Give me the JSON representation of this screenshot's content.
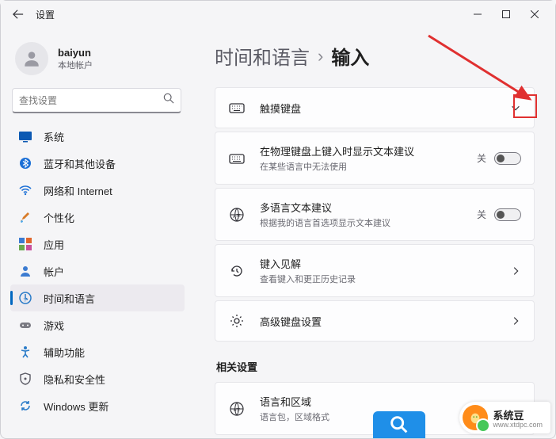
{
  "window": {
    "title": "设置"
  },
  "profile": {
    "name": "baiyun",
    "sub": "本地帐户"
  },
  "search": {
    "placeholder": "查找设置"
  },
  "nav": [
    {
      "key": "system",
      "label": "系统",
      "icon": "system"
    },
    {
      "key": "bluetooth",
      "label": "蓝牙和其他设备",
      "icon": "bluetooth"
    },
    {
      "key": "network",
      "label": "网络和 Internet",
      "icon": "wifi"
    },
    {
      "key": "personalization",
      "label": "个性化",
      "icon": "brush"
    },
    {
      "key": "apps",
      "label": "应用",
      "icon": "apps"
    },
    {
      "key": "accounts",
      "label": "帐户",
      "icon": "account"
    },
    {
      "key": "time-language",
      "label": "时间和语言",
      "icon": "time-lang",
      "active": true
    },
    {
      "key": "gaming",
      "label": "游戏",
      "icon": "gaming"
    },
    {
      "key": "accessibility",
      "label": "辅助功能",
      "icon": "accessibility"
    },
    {
      "key": "privacy",
      "label": "隐私和安全性",
      "icon": "privacy"
    },
    {
      "key": "windows-update",
      "label": "Windows 更新",
      "icon": "update"
    }
  ],
  "breadcrumb": {
    "parent": "时间和语言",
    "current": "输入"
  },
  "cards": {
    "touch_keyboard": {
      "title": "触摸键盘"
    },
    "physical_suggest": {
      "title": "在物理键盘上键入时显示文本建议",
      "sub": "在某些语言中无法使用",
      "state": "关"
    },
    "multilang_suggest": {
      "title": "多语言文本建议",
      "sub": "根据我的语言首选项显示文本建议",
      "state": "关"
    },
    "typing_insights": {
      "title": "键入见解",
      "sub": "查看键入和更正历史记录"
    },
    "advanced_keyboard": {
      "title": "高级键盘设置"
    }
  },
  "related": {
    "heading": "相关设置",
    "lang_region": {
      "title": "语言和区域",
      "sub": "语言包，区域格式"
    }
  },
  "watermark": {
    "brand": "系统豆",
    "url": "www.xtdpc.com"
  }
}
